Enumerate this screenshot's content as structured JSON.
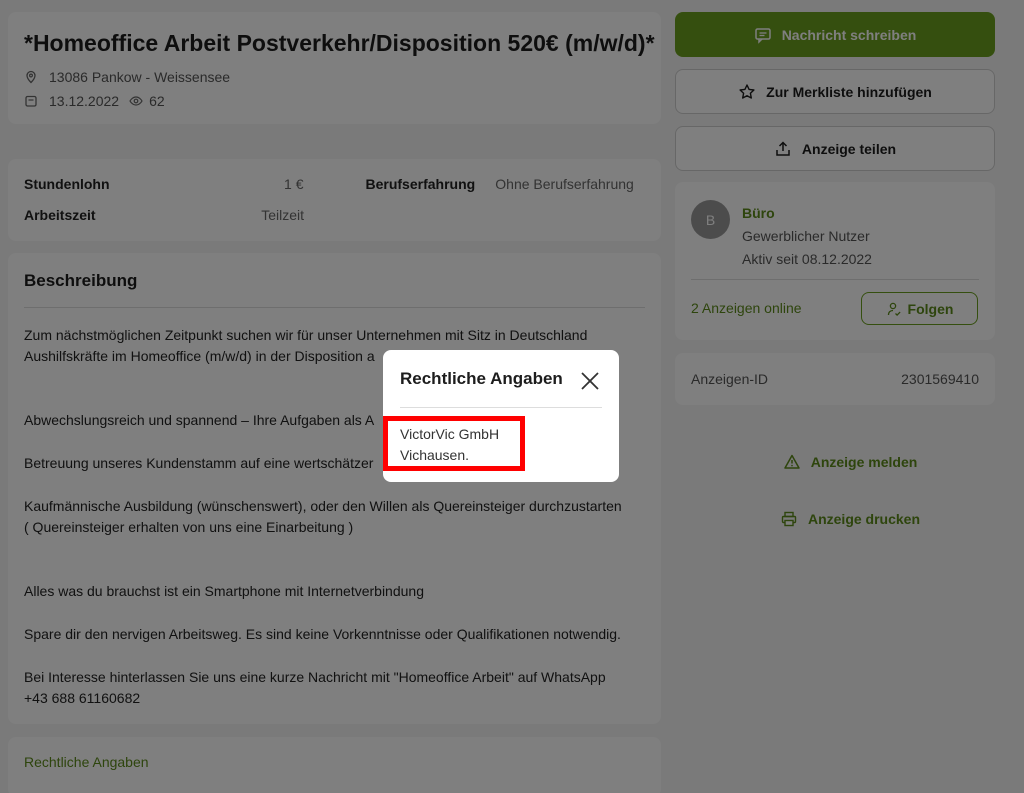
{
  "ad": {
    "title": "*Homeoffice Arbeit Postverkehr/Disposition 520€ (m/w/d)*",
    "location": "13086 Pankow - Weissensee",
    "date": "13.12.2022",
    "views": "62"
  },
  "details": {
    "label_wage": "Stundenlohn",
    "value_wage": "1 €",
    "label_experience": "Berufserfahrung",
    "value_experience": "Ohne Berufserfahrung",
    "label_hours": "Arbeitszeit",
    "value_hours": "Teilzeit"
  },
  "description": {
    "heading": "Beschreibung",
    "lines": [
      "Zum nächstmöglichen Zeitpunkt suchen wir für unser Unternehmen mit Sitz in Deutschland",
      "Aushilfskräfte im Homeoffice (m/w/d) in der Disposition a",
      "Abwechslungsreich und spannend – Ihre Aufgaben als A",
      "Betreuung unseres Kundenstamm auf eine wertschätzer",
      "Kaufmännische Ausbildung (wünschenswert), oder den Willen als Quereinsteiger durchzustarten",
      "( Quereinsteiger erhalten von uns eine Einarbeitung )",
      "Alles was du brauchst ist ein Smartphone mit Internetverbindung",
      "Spare dir den nervigen Arbeitsweg. Es sind keine Vorkenntnisse oder Qualifikationen notwendig.",
      "Bei Interesse hinterlassen Sie uns eine kurze Nachricht mit \"Homeoffice Arbeit\" auf WhatsApp",
      "+43 688 61160682"
    ]
  },
  "legal_link": "Rechtliche Angaben",
  "sidebar": {
    "message_button": "Nachricht schreiben",
    "watchlist_button": "Zur Merkliste hinzufügen",
    "share_button": "Anzeige teilen",
    "seller": {
      "initial": "B",
      "name": "Büro",
      "type": "Gewerblicher Nutzer",
      "active_since": "Aktiv seit 08.12.2022",
      "ads_online": "2 Anzeigen online",
      "follow_button": "Folgen"
    },
    "ad_id_label": "Anzeigen-ID",
    "ad_id_value": "2301569410",
    "report_link": "Anzeige melden",
    "print_link": "Anzeige drucken"
  },
  "modal": {
    "title": "Rechtliche Angaben",
    "company": "VictorVic GmbH",
    "city": "Vichausen."
  },
  "colors": {
    "brand_green": "#6b9f1e",
    "highlight": "#ff0000"
  }
}
